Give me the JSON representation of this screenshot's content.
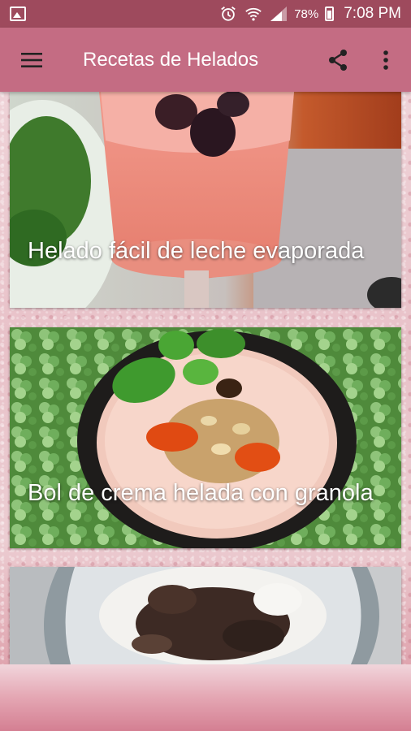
{
  "status_bar": {
    "battery_percent": "78%",
    "time": "7:08 PM"
  },
  "app_bar": {
    "title": "Recetas de Helados"
  },
  "recipes": [
    {
      "title": "Helado fácil de leche evaporada"
    },
    {
      "title": "Bol de crema helada con granola"
    },
    {
      "title": ""
    }
  ],
  "colors": {
    "status_bar": "#9e4a5d",
    "app_bar": "#c46c83",
    "background": "#e9c6cc"
  },
  "icons": [
    "image-icon",
    "alarm-icon",
    "wifi-icon",
    "signal-icon",
    "battery-icon",
    "menu-icon",
    "share-icon",
    "more-vert-icon"
  ]
}
